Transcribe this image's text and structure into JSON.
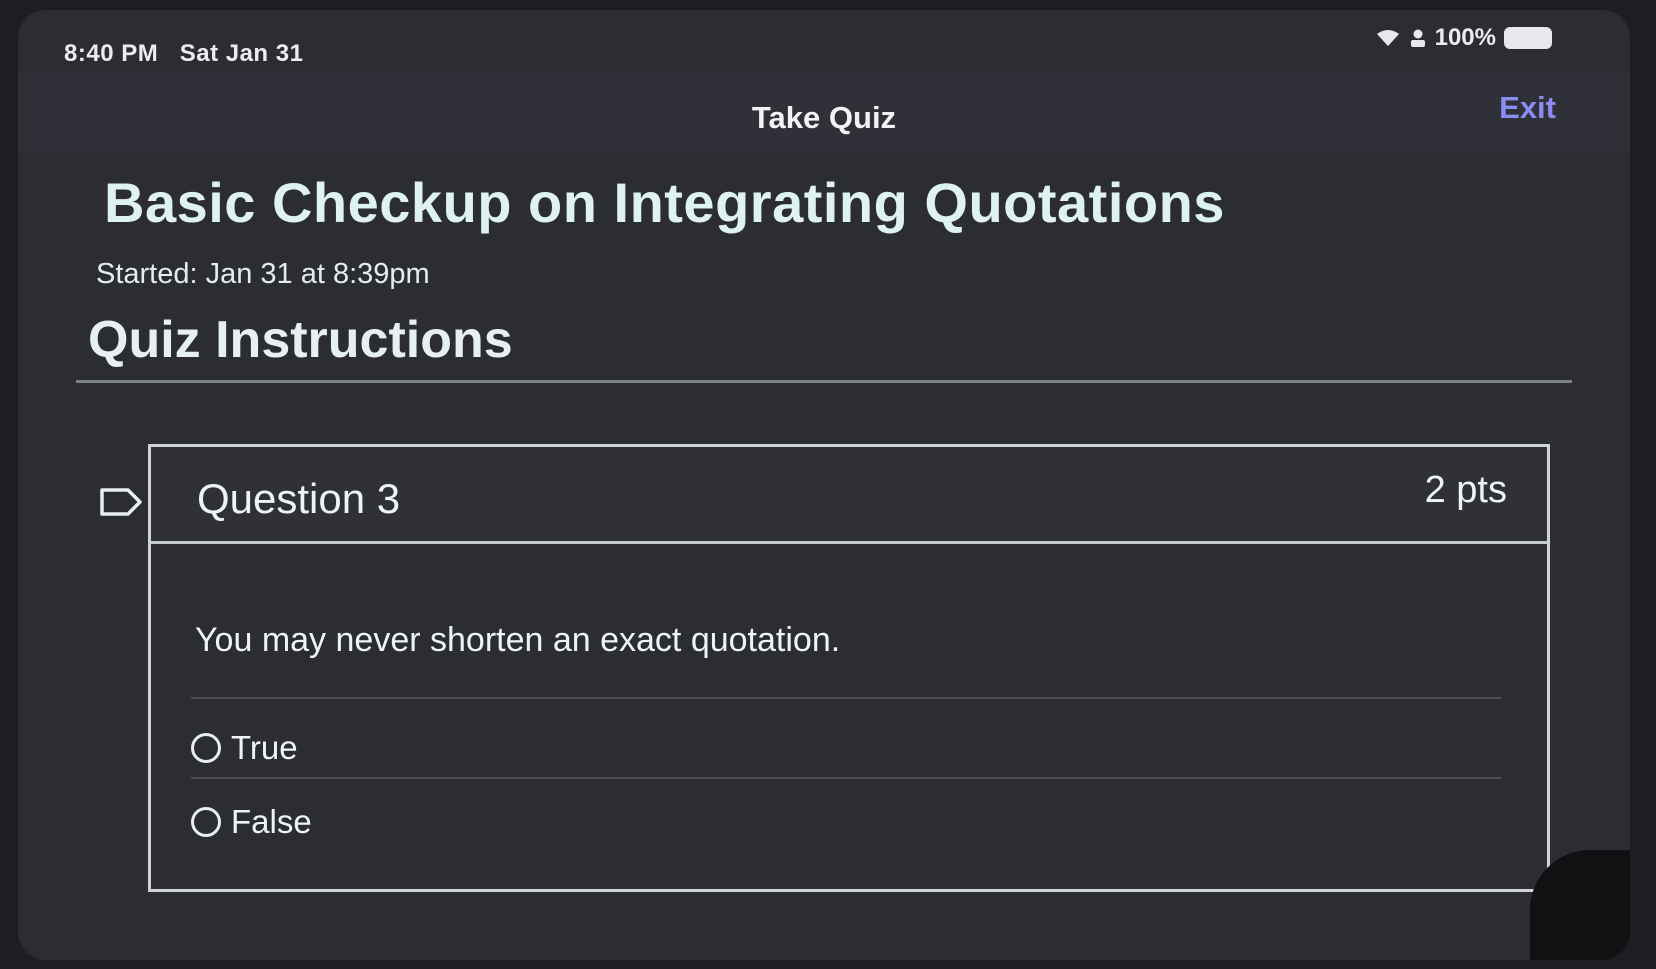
{
  "status_bar": {
    "time": "8:40 PM",
    "date": "Sat Jan 31",
    "battery": "100%",
    "icons": [
      "wifi-icon",
      "person-icon",
      "battery-icon"
    ]
  },
  "nav": {
    "title": "Take Quiz",
    "exit_label": "Exit"
  },
  "quiz": {
    "title": "Basic Checkup on Integrating Quotations",
    "started": "Started: Jan 31 at 8:39pm",
    "instructions_heading": "Quiz Instructions"
  },
  "question": {
    "number_label": "Question 3",
    "points": "2 pts",
    "text": "You may never shorten an exact quotation.",
    "options": [
      {
        "label": "True",
        "selected": false
      },
      {
        "label": "False",
        "selected": false
      }
    ]
  },
  "colors": {
    "background": "#2c2c33",
    "accent_link": "#8b8cf0",
    "text": "#eef4f4",
    "border": "#cfd3d5"
  }
}
